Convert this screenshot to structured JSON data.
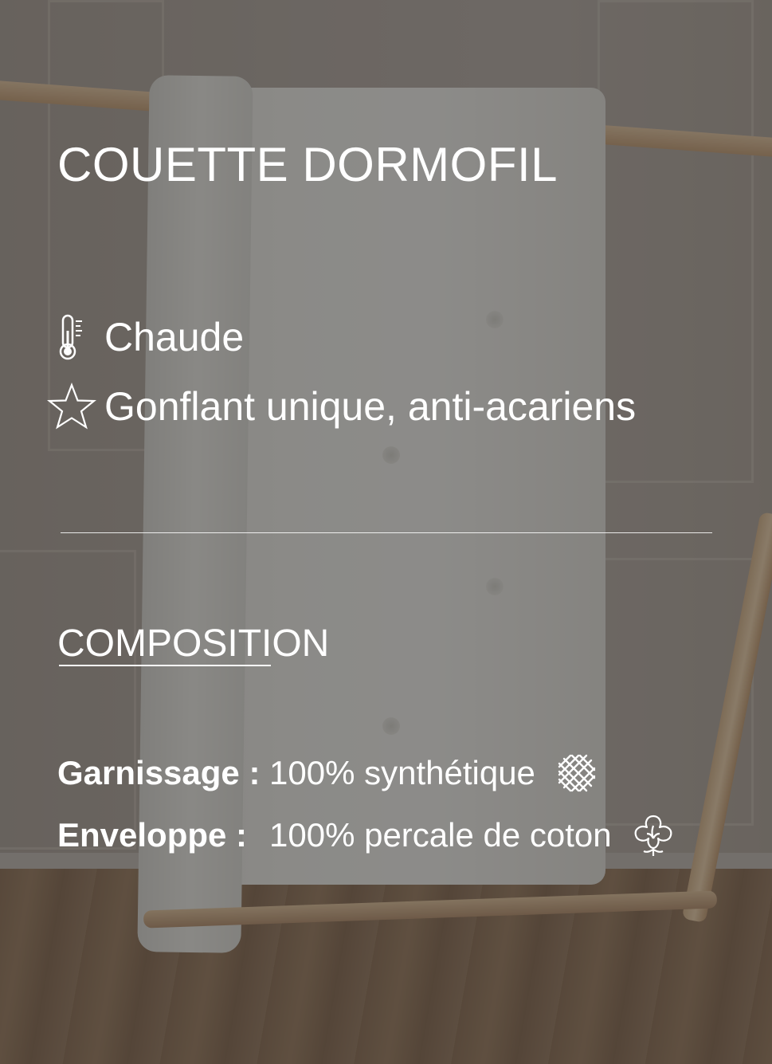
{
  "product": {
    "title": "COUETTE DORMOFIL"
  },
  "features": [
    {
      "icon": "thermometer-icon",
      "label": "Chaude"
    },
    {
      "icon": "star-icon",
      "label": "Gonflant unique, anti-acariens"
    }
  ],
  "composition": {
    "title": "COMPOSITION",
    "rows": [
      {
        "key": "Garnissage :",
        "value": "100% synthétique",
        "icon": "synthetic-fiber-icon"
      },
      {
        "key": "Enveloppe  :",
        "value": "100% percale de coton",
        "icon": "cotton-flower-icon"
      }
    ]
  },
  "colors": {
    "text": "#ffffff",
    "overlay": "rgba(55,55,55,0.52)"
  }
}
